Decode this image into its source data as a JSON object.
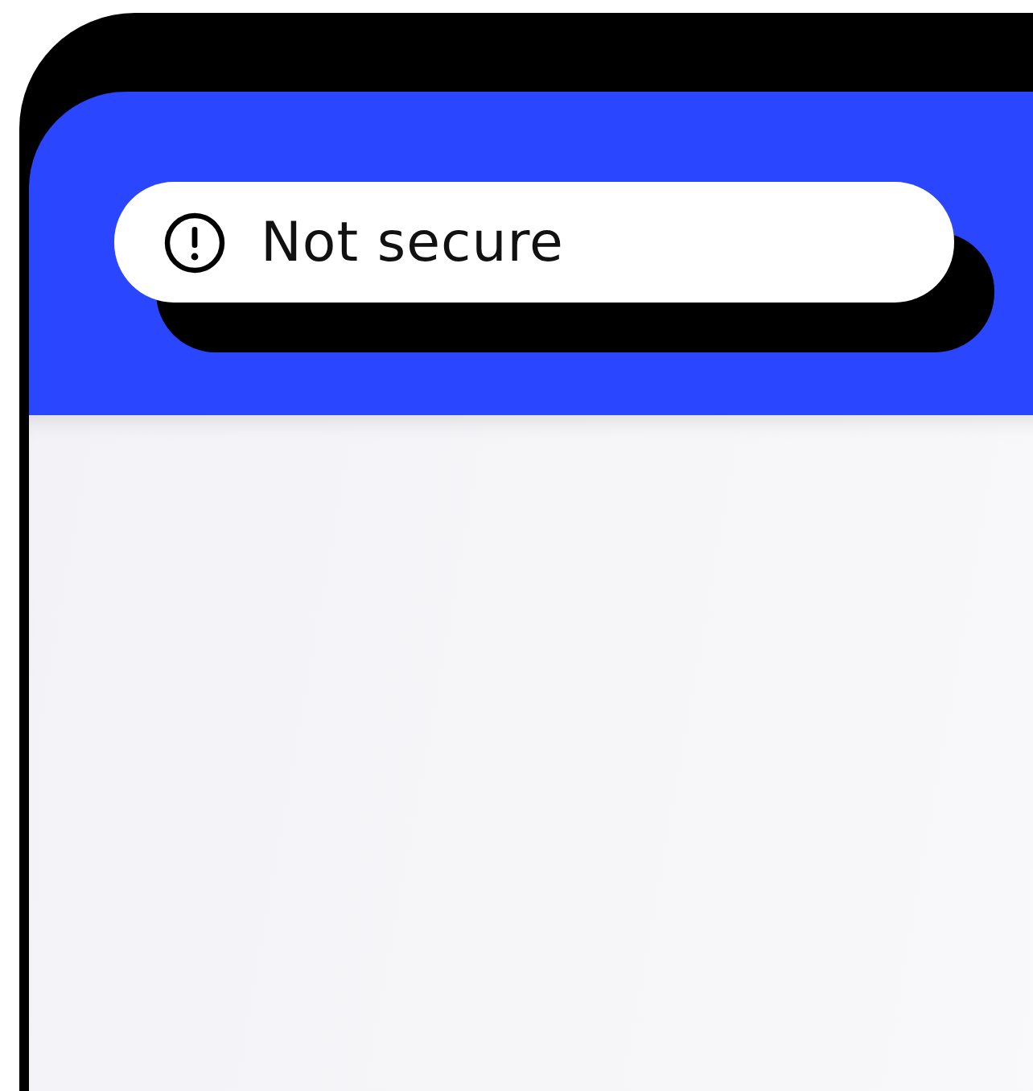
{
  "address_bar": {
    "text": "Not secure"
  }
}
